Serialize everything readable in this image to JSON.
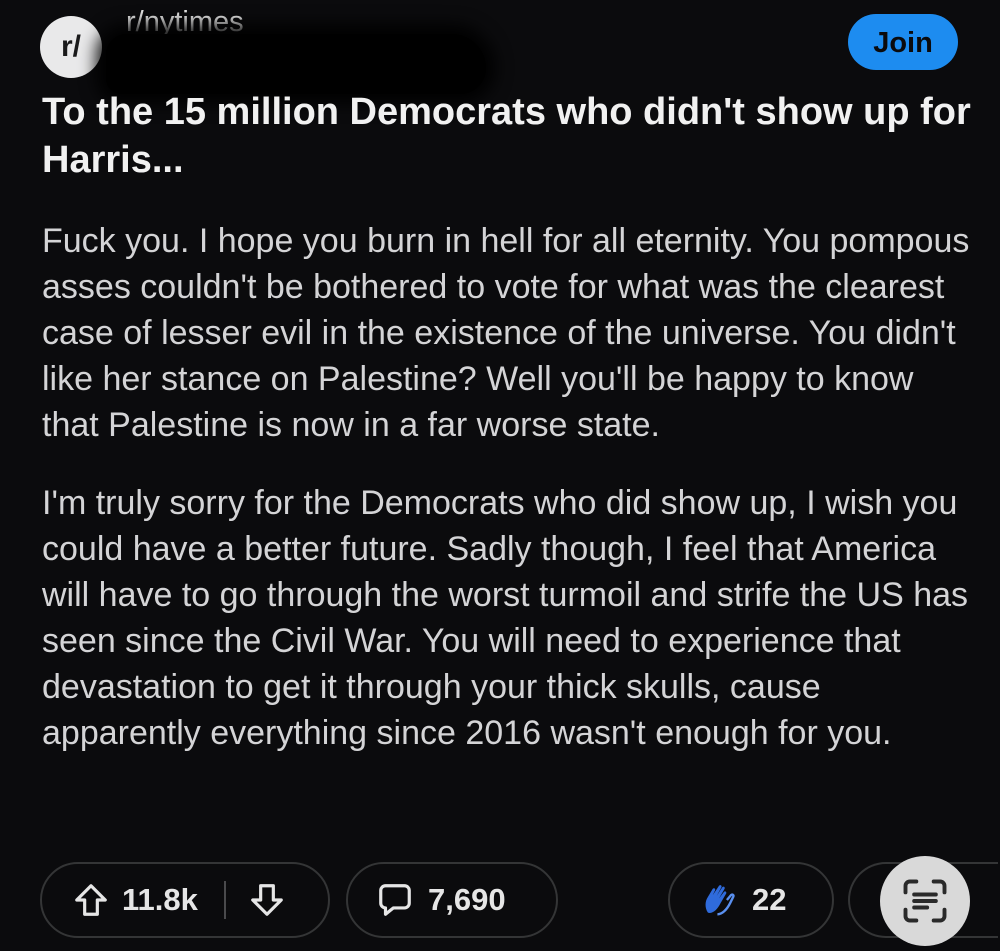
{
  "header": {
    "subreddit_icon_text": "r/",
    "subreddit_name": "r/nytimes",
    "join_label": "Join"
  },
  "post": {
    "title": "To the 15 million Democrats who didn't show up for Harris...",
    "paragraphs": [
      "Fuck you. I hope you burn in hell for all eternity. You pompous asses couldn't be bothered to vote for what was the clearest case of lesser evil in the existence of the universe. You didn't like her stance on Palestine? Well you'll be happy to know that Palestine is now in a far worse state.",
      "I'm truly sorry for the Democrats who did show up, I wish you could have a better future. Sadly though, I feel that America will have to go through the worst turmoil and strife the US has seen since the Civil War. You will need to experience that devastation to get it through your thick skulls, cause apparently everything since 2016 wasn't enough for you."
    ]
  },
  "actions": {
    "upvotes": "11.8k",
    "comments": "7,690",
    "awards": "22"
  },
  "icons": {
    "upvote": "upvote-arrow-icon",
    "downvote": "downvote-arrow-icon",
    "comment": "comment-bubble-icon",
    "award": "clapping-hands-icon",
    "scan": "text-scan-icon"
  },
  "colors": {
    "background": "#0b0b0d",
    "join_button": "#1d8cf0",
    "award_icon": "#2f6bdc"
  }
}
